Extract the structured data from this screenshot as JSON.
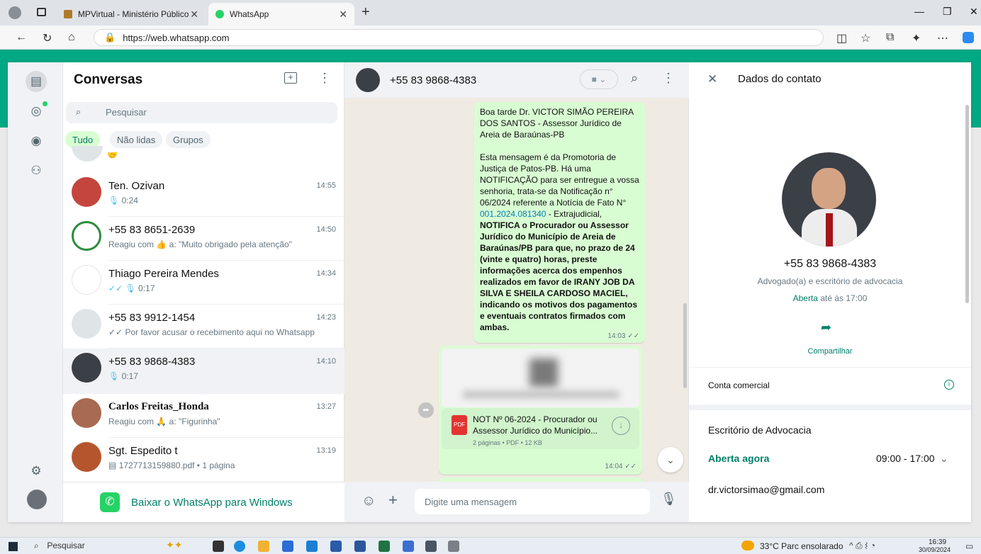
{
  "browser": {
    "tabs": [
      {
        "title": "MPVirtual - Ministério Público da"
      },
      {
        "title": "WhatsApp"
      }
    ],
    "url": "https://web.whatsapp.com"
  },
  "sidebar": {
    "title": "Conversas",
    "search_placeholder": "Pesquisar",
    "filters": [
      "Tudo",
      "Não lidas",
      "Grupos"
    ],
    "chats": [
      {
        "name": "Ten. Ozivan",
        "time": "14:55",
        "preview": "0:24"
      },
      {
        "name": "+55 83 8651-2639",
        "time": "14:50",
        "preview": "Reagiu com 👍 a: \"Muito obrigado pela atenção\""
      },
      {
        "name": "Thiago Pereira Mendes",
        "time": "14:34",
        "preview": "0:17"
      },
      {
        "name": "+55 83 9912-1454",
        "time": "14:23",
        "preview": "Por favor acusar o recebimento aqui no Whatsapp"
      },
      {
        "name": "+55 83 9868-4383",
        "time": "14:10",
        "preview": "0:17"
      },
      {
        "name": "Carlos Freitas_Honda",
        "time": "13:27",
        "preview": "Reagiu com 🙏 a: \"Figurinha\""
      },
      {
        "name": "Sgt. Espedito t",
        "time": "13:19",
        "preview": "1727713159880.pdf • 1 página"
      }
    ],
    "download_banner": "Baixar o WhatsApp para Windows"
  },
  "conversation": {
    "contact": "+55 83 9868-4383",
    "message": {
      "p1": "Boa tarde Dr. VICTOR SIMÃO PEREIRA DOS SANTOS - Assessor Jurídico de Areia de Baraúnas-PB",
      "p2a": "Esta mensagem é da Promotoria de Justiça de Patos-PB. Há uma NOTIFICAÇÃO para ser entregue a vossa senhoria, trata-se da Notificação n° 06/2024 referente a Notícia de Fato N°",
      "link": "001.2024.081340",
      "p2b": " - Extrajudicial,",
      "bold": "NOTIFICA o Procurador ou Assessor Jurídico do Município de Areia de Baraúnas/PB para que, no prazo de 24 (vinte e quatro) horas, preste informações acerca dos empenhos realizados em favor de IRANY JOB DA SILVA E SHEILA CARDOSO MACIEL, indicando os motivos dos pagamentos e eventuais contratos firmados com ambas.",
      "time": "14:03"
    },
    "attachment": {
      "name": "NOT Nº 06-2024 - Procurador ou Assessor Jurídico do Município...",
      "meta": "2 páginas • PDF • 12 KB",
      "time": "14:04",
      "type_label": "PDF"
    },
    "input_placeholder": "Digite uma mensagem"
  },
  "contact_info": {
    "header": "Dados do contato",
    "phone": "+55 83 9868-4383",
    "category": "Advogado(a) e escritório de advocacia",
    "open_word": "Aberta",
    "open_suffix": " até às 17:00",
    "share": "Compartilhar",
    "business": "Conta comercial",
    "office": "Escritório de Advocacia",
    "open_now": "Aberta agora",
    "hours": "09:00 - 17:00",
    "email": "dr.victorsimao@gmail.com"
  },
  "taskbar": {
    "search": "Pesquisar",
    "weather": "33°C  Parc ensolarado",
    "time": "16:39",
    "date": "30/09/2024"
  },
  "colors": {
    "accent": "#00a884",
    "bubble": "#d9fdd3",
    "link": "#027eb5"
  }
}
